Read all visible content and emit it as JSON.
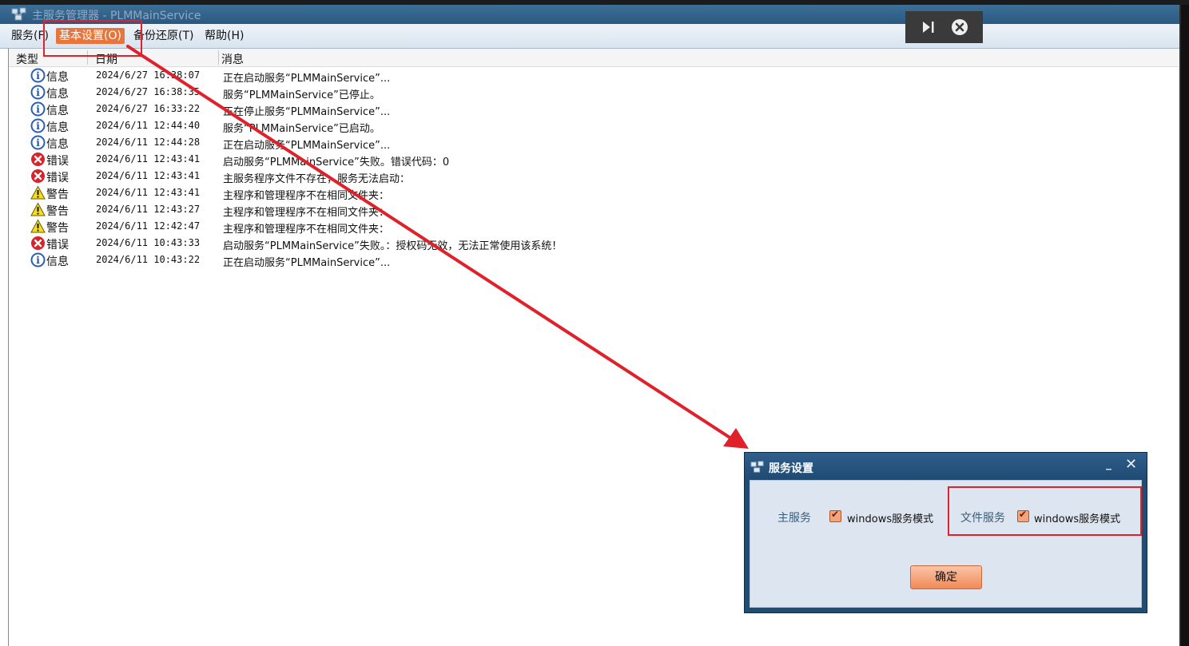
{
  "window": {
    "title": "主服务管理器 - PLMMainService"
  },
  "menu": [
    {
      "label": "服务(F)"
    },
    {
      "label": "基本设置(O)"
    },
    {
      "label": "备份还原(T)"
    },
    {
      "label": "帮助(H)"
    }
  ],
  "columns": {
    "type": "类型",
    "date": "日期",
    "message": "消息"
  },
  "rows": [
    {
      "icon": "info-icon",
      "type": "信息",
      "date": "2024/6/27 16:38:07",
      "message": "正在启动服务“PLMMainService”..."
    },
    {
      "icon": "info-icon",
      "type": "信息",
      "date": "2024/6/27 16:38:35",
      "message": "服务“PLMMainService”已停止。"
    },
    {
      "icon": "info-icon",
      "type": "信息",
      "date": "2024/6/27 16:33:22",
      "message": "正在停止服务“PLMMainService”..."
    },
    {
      "icon": "info-icon",
      "type": "信息",
      "date": "2024/6/11 12:44:40",
      "message": "服务“PLMMainService”已启动。"
    },
    {
      "icon": "info-icon",
      "type": "信息",
      "date": "2024/6/11 12:44:28",
      "message": "正在启动服务“PLMMainService”..."
    },
    {
      "icon": "error-icon",
      "type": "错误",
      "date": "2024/6/11 12:43:41",
      "message": "启动服务“PLMMainService”失败。错误代码：0"
    },
    {
      "icon": "error-icon",
      "type": "错误",
      "date": "2024/6/11 12:43:41",
      "message": "主服务程序文件不存在，服务无法启动："
    },
    {
      "icon": "warning-icon",
      "type": "警告",
      "date": "2024/6/11 12:43:41",
      "message": "主程序和管理程序不在相同文件夹："
    },
    {
      "icon": "warning-icon",
      "type": "警告",
      "date": "2024/6/11 12:43:27",
      "message": "主程序和管理程序不在相同文件夹："
    },
    {
      "icon": "warning-icon",
      "type": "警告",
      "date": "2024/6/11 12:42:47",
      "message": "主程序和管理程序不在相同文件夹："
    },
    {
      "icon": "error-icon",
      "type": "错误",
      "date": "2024/6/11 10:43:33",
      "message": "启动服务“PLMMainService”失败。：授权码无效，无法正常使用该系统！"
    },
    {
      "icon": "info-icon",
      "type": "信息",
      "date": "2024/6/11 10:43:22",
      "message": "正在启动服务“PLMMainService”..."
    }
  ],
  "dialog": {
    "title": "服务设置",
    "main_service_label": "主服务",
    "main_service_option": "windows服务模式",
    "main_service_checked": true,
    "file_service_label": "文件服务",
    "file_service_option": "windows服务模式",
    "file_service_checked": true,
    "ok_label": "确定"
  },
  "colors": {
    "highlight": "#e0202a",
    "menu_active": "#e8763c",
    "titlebar": "#2b5880"
  }
}
